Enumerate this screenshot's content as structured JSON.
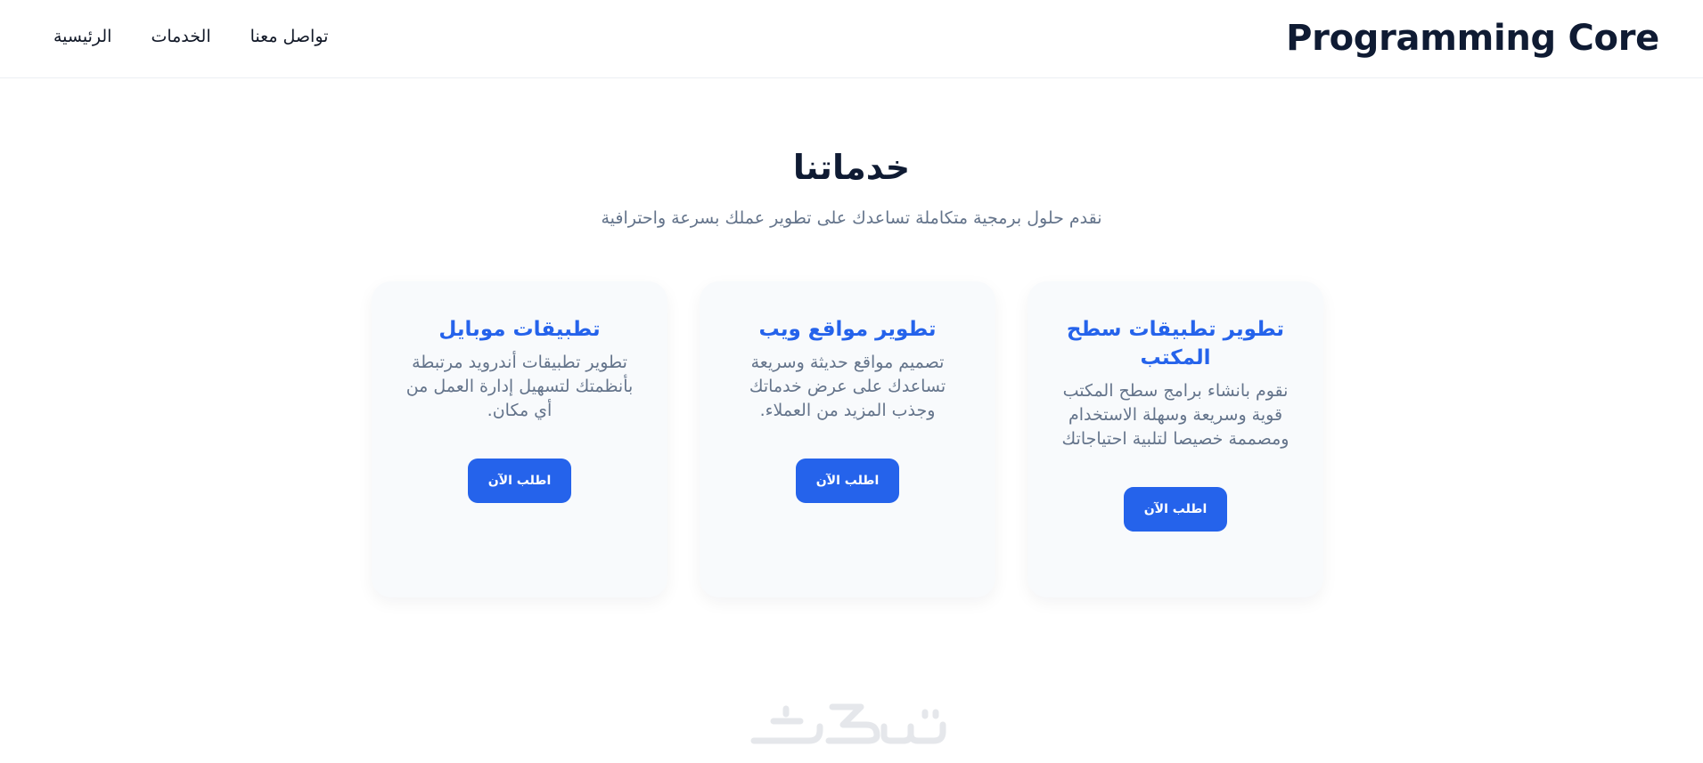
{
  "header": {
    "brand": "Programming Core",
    "nav": [
      {
        "label": "الرئيسية"
      },
      {
        "label": "الخدمات"
      },
      {
        "label": "تواصل معنا"
      }
    ]
  },
  "services": {
    "title": "خدماتنا",
    "subtitle": "نقدم حلول برمجية متكاملة تساعدك على تطوير عملك بسرعة واحترافية",
    "cards": [
      {
        "title": "تطوير تطبيقات سطح المكتب",
        "description": "نقوم بانشاء برامج سطح المكتب قوية وسريعة وسهلة الاستخدام ومصممة خصيصا لتلبية احتياجاتك",
        "button": "اطلب الآن"
      },
      {
        "title": "تطوير مواقع ويب",
        "description": "تصميم مواقع حديثة وسريعة تساعدك على عرض خدماتك وجذب المزيد من العملاء.",
        "button": "اطلب الآن"
      },
      {
        "title": "تطبيقات موبايل",
        "description": "تطوير تطبيقات أندرويد مرتبطة بأنظمتك لتسهيل إدارة العمل من أي مكان.",
        "button": "اطلب الآن"
      }
    ]
  },
  "footer": {
    "watermark_logo": "خمسات"
  },
  "colors": {
    "accent": "#2563eb",
    "heading": "#0f1b33",
    "muted": "#64748b",
    "card_bg": "#f8fafc"
  }
}
